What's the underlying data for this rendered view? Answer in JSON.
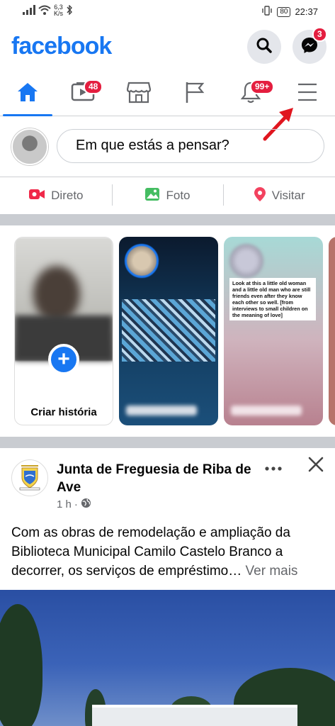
{
  "status_bar": {
    "network_speed": "6,3",
    "network_unit": "K/s",
    "battery": "80",
    "time": "22:37"
  },
  "header": {
    "logo": "facebook",
    "messenger_badge": "3"
  },
  "tabs": {
    "watch_badge": "48",
    "notifications_badge": "99+"
  },
  "composer": {
    "placeholder": "Em que estás a pensar?"
  },
  "actions": [
    {
      "label": "Direto",
      "icon": "video-camera-icon",
      "color": "#f02849"
    },
    {
      "label": "Foto",
      "icon": "photo-icon",
      "color": "#45bd62"
    },
    {
      "label": "Visitar",
      "icon": "location-pin-icon",
      "color": "#f3425f"
    }
  ],
  "stories": {
    "create_label": "Criar história",
    "story3_quote": "Look at this a little old woman and a little old man who are still friends even after they know each other so well. [from interviews to small children on the meaning of love]"
  },
  "post": {
    "page_name": "Junta de Freguesia de Riba de Ave",
    "time": "1 h",
    "text": "Com as obras de remodelação e ampliação da Biblioteca Municipal Camilo Castelo Branco a decorrer, os serviços de empréstimo…",
    "see_more": "Ver mais"
  },
  "colors": {
    "brand": "#1877f2",
    "badge": "#e41e3f"
  }
}
